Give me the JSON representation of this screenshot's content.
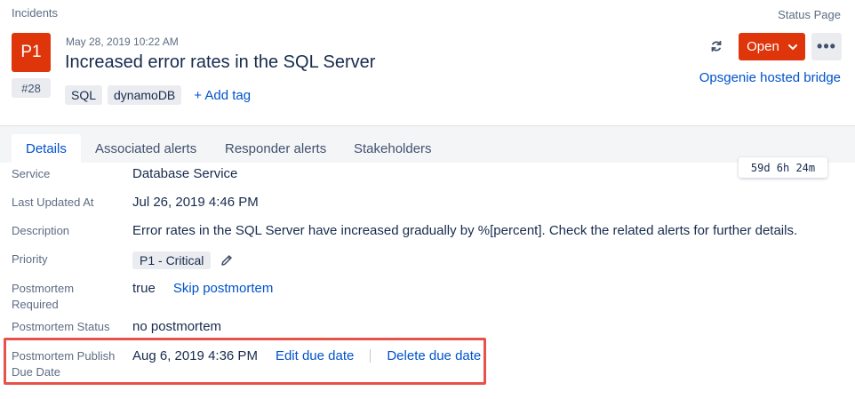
{
  "header": {
    "breadcrumb": "Incidents",
    "status_page": "Status Page",
    "priority": "P1",
    "incident_number": "#28",
    "timestamp": "May 28, 2019 10:22 AM",
    "title": "Increased error rates in the SQL Server",
    "tags": [
      "SQL",
      "dynamoDB"
    ],
    "add_tag": "+ Add tag",
    "open_label": "Open",
    "more_label": "•••",
    "bridge_link": "Opsgenie hosted bridge",
    "accent_color": "#de350b"
  },
  "tabs": [
    {
      "label": "Details",
      "active": true
    },
    {
      "label": "Associated alerts",
      "active": false
    },
    {
      "label": "Responder alerts",
      "active": false
    },
    {
      "label": "Stakeholders",
      "active": false
    }
  ],
  "timer": "59d 6h 24m",
  "details": {
    "service": {
      "label": "Service",
      "value": "Database Service"
    },
    "last_updated": {
      "label": "Last Updated At",
      "value": "Jul 26, 2019 4:46 PM"
    },
    "description": {
      "label": "Description",
      "value": "Error rates in the SQL Server have increased gradually by %[percent]. Check the related alerts for further details."
    },
    "priority": {
      "label": "Priority",
      "value": "P1 - Critical"
    },
    "postmortem_required": {
      "label_line1": "Postmortem",
      "label_line2": "Required",
      "value": "true",
      "action": "Skip postmortem"
    },
    "postmortem_status": {
      "label": "Postmortem Status",
      "value": "no postmortem"
    },
    "postmortem_due": {
      "label_line1": "Postmortem Publish",
      "label_line2": "Due Date",
      "value": "Aug 6, 2019 4:36 PM",
      "edit": "Edit due date",
      "delete": "Delete due date"
    }
  }
}
